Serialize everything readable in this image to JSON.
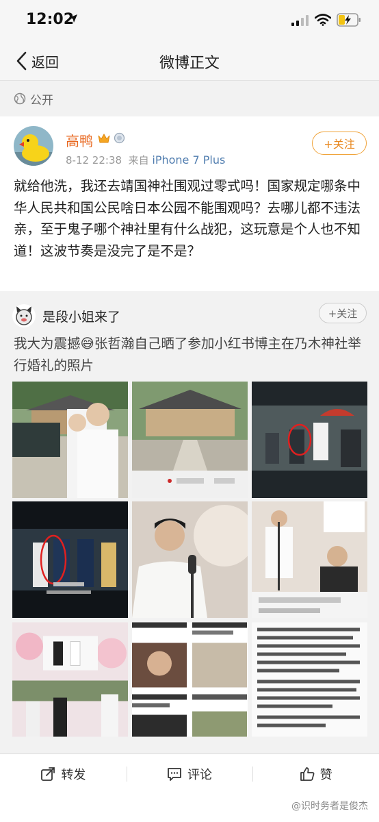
{
  "status_bar": {
    "time": "12:02"
  },
  "nav": {
    "back_label": "返回",
    "title": "微博正文"
  },
  "visibility": {
    "label": "公开"
  },
  "post": {
    "author": "高鸭",
    "time": "8-12 22:38",
    "source_prefix": "来自",
    "source": "iPhone 7 Plus",
    "follow_label": "+关注",
    "text": "就给他洗，我还去靖国神社围观过零式吗！国家规定哪条中华人民共和国公民啥日本公园不能围观吗？去哪儿都不违法亲，至于鬼子哪个神社里有什么战犯，这玩意是个人也不知道！这波节奏是没完了是不是？"
  },
  "repost": {
    "author": "是段小姐来了",
    "follow_label": "+关注",
    "text": "我大为震撼😅张哲瀚自己晒了参加小红书博主在乃木神社举行婚礼的照片"
  },
  "actions": {
    "repost": "转发",
    "comment": "评论",
    "like": "赞"
  },
  "watermark": "@识时务者是俊杰"
}
